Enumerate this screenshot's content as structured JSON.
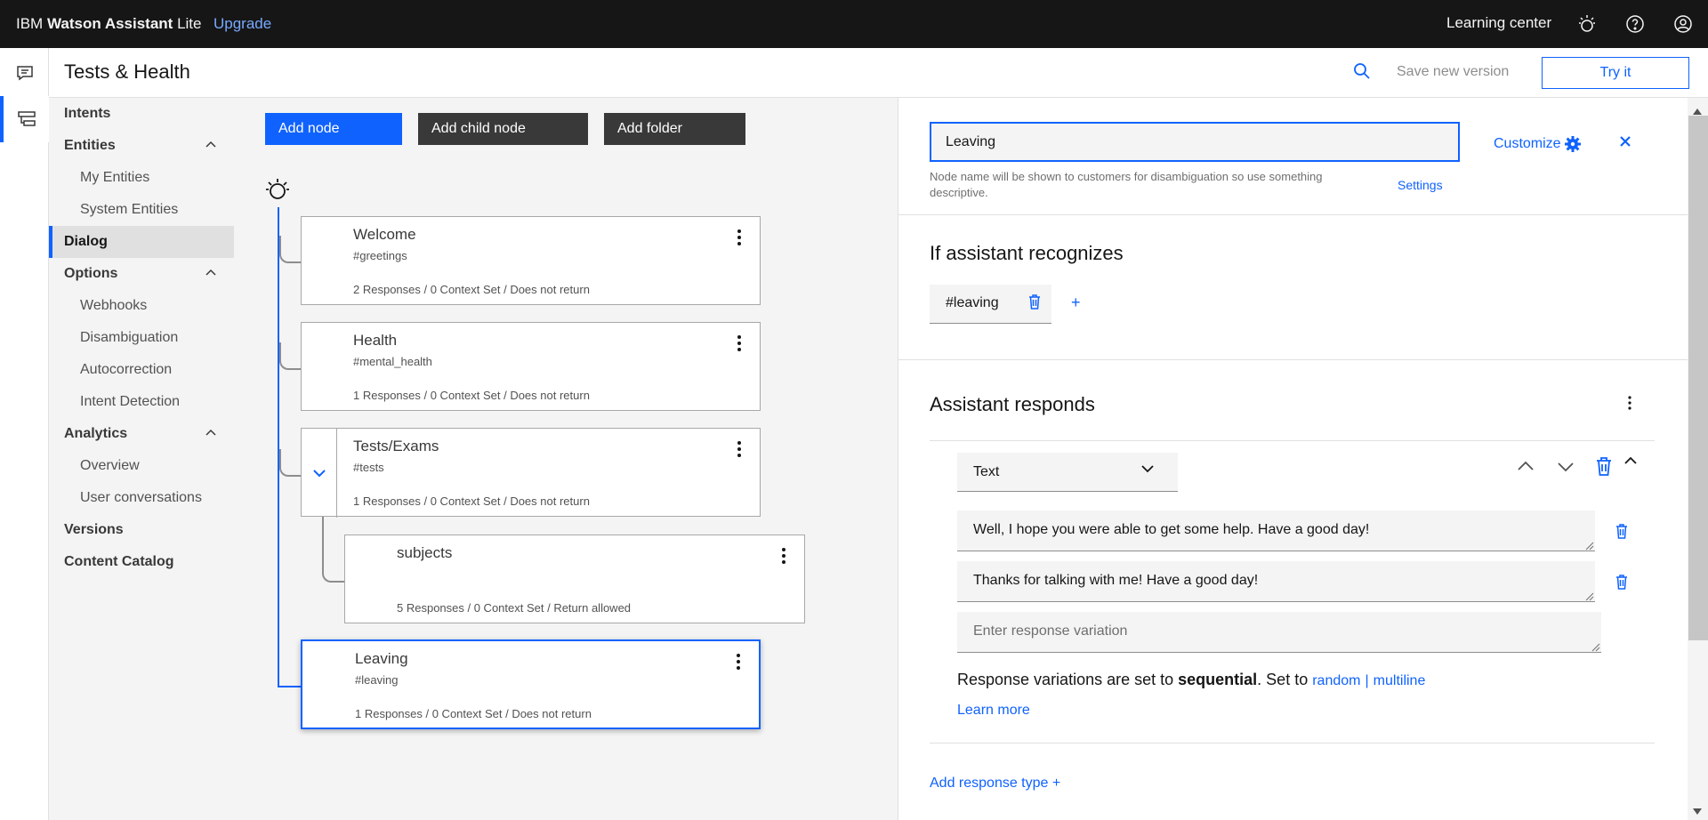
{
  "topbar": {
    "brand_prefix": "IBM",
    "brand_bold": "Watson Assistant",
    "brand_suffix": "Lite",
    "upgrade": "Upgrade",
    "learning_center": "Learning center",
    "icons": [
      "watson-icon",
      "help-icon",
      "user-avatar-icon"
    ]
  },
  "rail": {
    "icons": [
      "chat-icon",
      "dialog-tree-icon"
    ]
  },
  "header": {
    "title": "Tests & Health",
    "save_version": "Save new version",
    "try_it": "Try it"
  },
  "sidenav": {
    "intents": "Intents",
    "entities": "Entities",
    "my_entities": "My Entities",
    "system_entities": "System Entities",
    "dialog": "Dialog",
    "options": "Options",
    "webhooks": "Webhooks",
    "disambiguation": "Disambiguation",
    "autocorrection": "Autocorrection",
    "intent_detection": "Intent Detection",
    "analytics": "Analytics",
    "overview": "Overview",
    "user_conversations": "User conversations",
    "versions": "Versions",
    "content_catalog": "Content Catalog"
  },
  "toolbar": {
    "add_node": "Add node",
    "add_child_node": "Add child node",
    "add_folder": "Add folder"
  },
  "nodes": [
    {
      "title": "Welcome",
      "condition": "#greetings",
      "meta": "2 Responses / 0 Context Set / Does not return"
    },
    {
      "title": "Health",
      "condition": "#mental_health",
      "meta": "1 Responses / 0 Context Set / Does not return"
    },
    {
      "title": "Tests/Exams",
      "condition": "#tests",
      "meta": "1 Responses / 0 Context Set / Does not return"
    },
    {
      "title": "subjects",
      "condition": "",
      "meta": "5 Responses / 0 Context Set / Return allowed"
    },
    {
      "title": "Leaving",
      "condition": "#leaving",
      "meta": "1 Responses / 0 Context Set / Does not return"
    }
  ],
  "panel": {
    "node_name": "Leaving",
    "hint": "Node name will be shown to customers for disambiguation so use something descriptive.",
    "settings": "Settings",
    "customize": "Customize",
    "recognizes_title": "If assistant recognizes",
    "condition_tag": "#leaving",
    "responds_title": "Assistant responds",
    "response_type": "Text",
    "responses": [
      "Well, I hope you were able to get some help. Have a good day!",
      "Thanks for talking with me! Have a good day!"
    ],
    "response_placeholder": "Enter response variation",
    "variation_prefix": "Response variations are set to ",
    "variation_mode": "sequential",
    "variation_mid": ". Set to ",
    "random": "random",
    "separator": "|",
    "multiline": "multiline",
    "learn_more": "Learn more",
    "add_response_type": "Add response type",
    "plus": "+"
  },
  "colors": {
    "accent": "#0f62fe",
    "topbar": "#161616"
  }
}
